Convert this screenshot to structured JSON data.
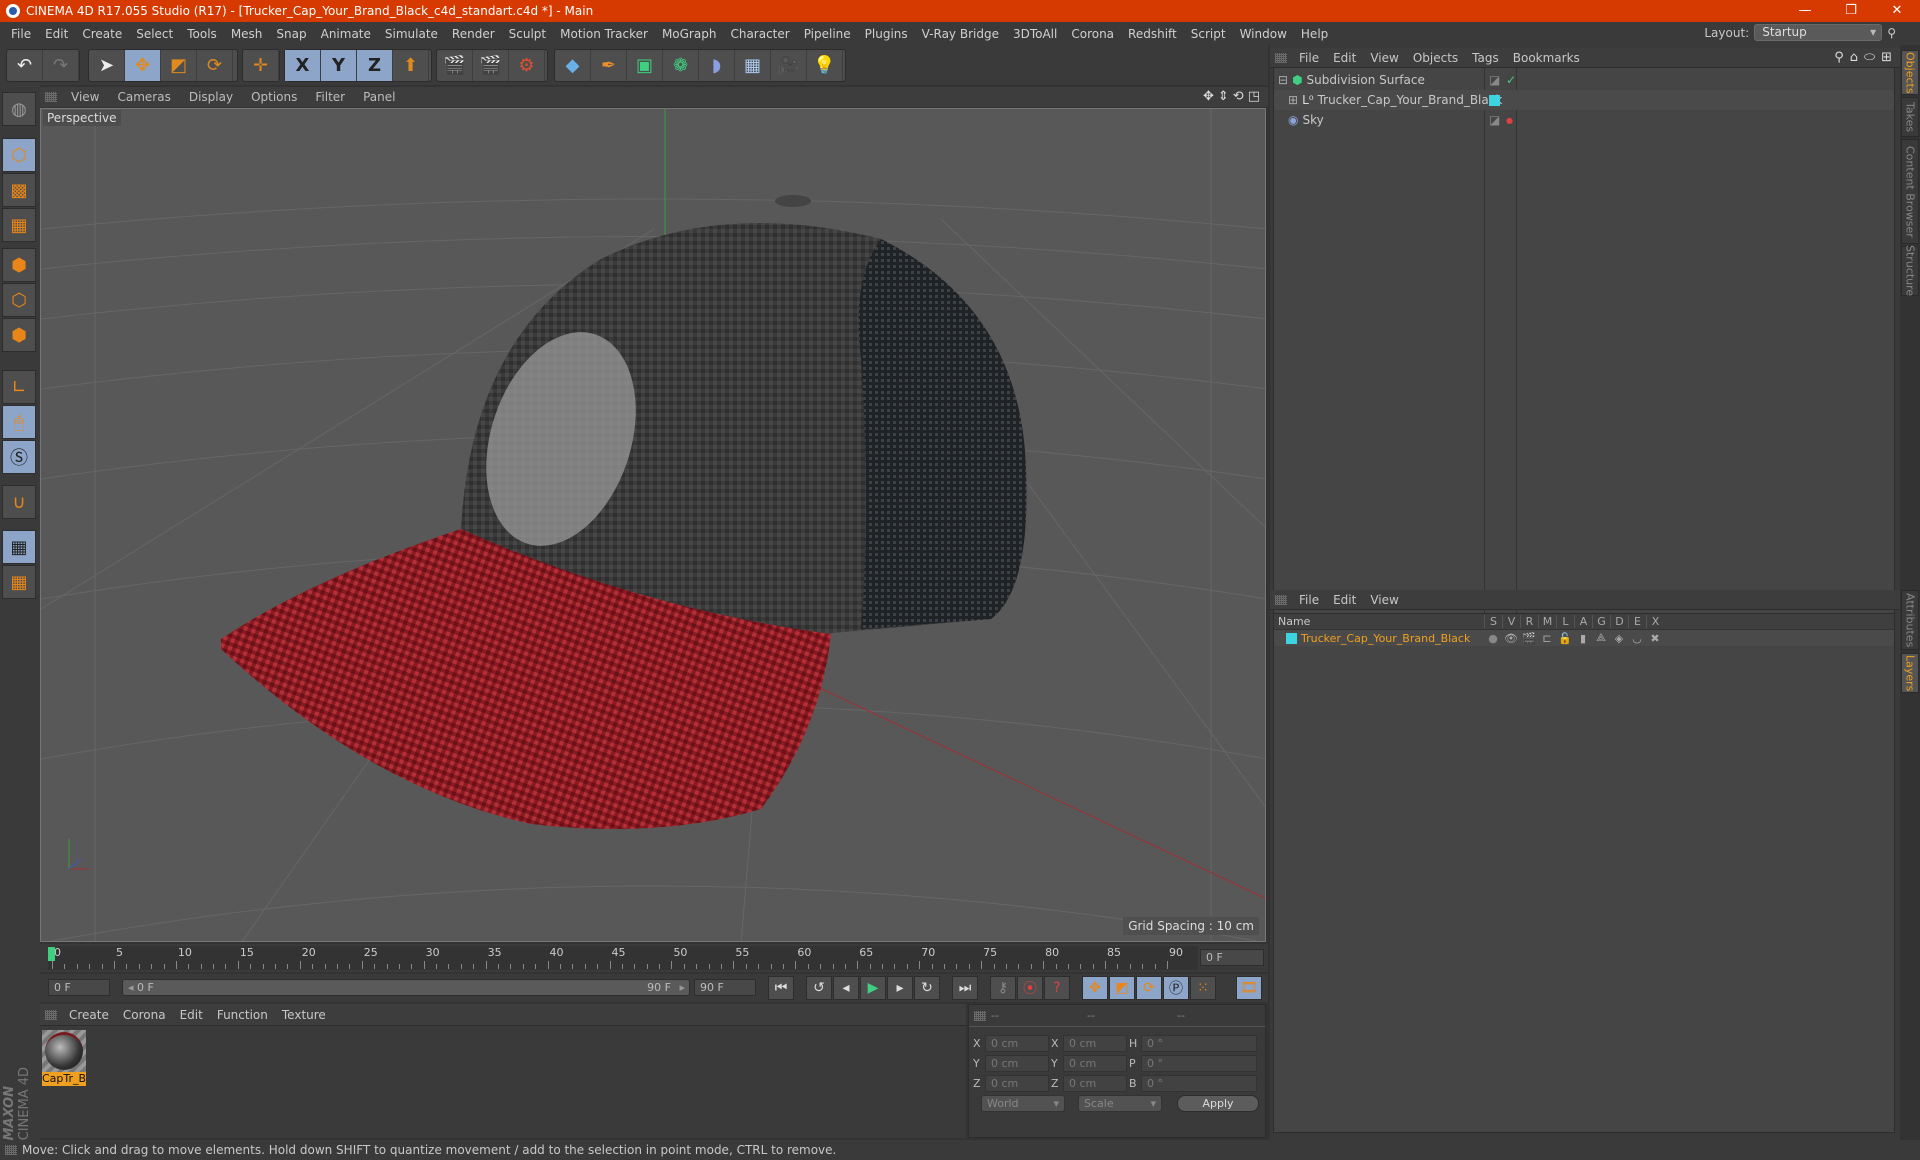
{
  "window": {
    "title": "CINEMA 4D R17.055 Studio (R17) - [Trucker_Cap_Your_Brand_Black_c4d_standart.c4d *] - Main",
    "controls": [
      "minimize",
      "restore",
      "close"
    ]
  },
  "menubar": {
    "items": [
      "File",
      "Edit",
      "Create",
      "Select",
      "Tools",
      "Mesh",
      "Snap",
      "Animate",
      "Simulate",
      "Render",
      "Sculpt",
      "Motion Tracker",
      "MoGraph",
      "Character",
      "Pipeline",
      "Plugins",
      "V-Ray Bridge",
      "3DToAll",
      "Corona",
      "Redshift",
      "Script",
      "Window",
      "Help"
    ],
    "layout_label": "Layout:",
    "layout_value": "Startup"
  },
  "toolbar": {
    "groups": [
      [
        "undo-icon",
        "redo-icon"
      ],
      [
        "select-icon",
        "move-icon",
        "scale-icon",
        "rotate-icon"
      ],
      [
        "live-move-icon"
      ],
      [
        "x-axis-icon",
        "y-axis-icon",
        "z-axis-icon",
        "coordinate-system-icon"
      ],
      [
        "render-view-icon",
        "render-picture-viewer-icon",
        "render-settings-icon"
      ],
      [
        "cube-icon",
        "pen-spline-icon",
        "subdivision-icon",
        "cloner-icon",
        "deformer-icon",
        "floor-icon",
        "camera-icon",
        "light-icon"
      ]
    ],
    "axis_labels": [
      "X",
      "Y",
      "Z"
    ]
  },
  "left_tools": [
    "model-mode-icon",
    "object-mode-icon",
    "texture-mode-icon",
    "workplane-mode-icon",
    "points-mode-icon",
    "edges-mode-icon",
    "polygons-mode-icon",
    "axis-mode-icon",
    "tweak-mode-icon",
    "snap-settings-icon",
    "magnet-icon",
    "workplane-lock-icon",
    "workplane-align-icon"
  ],
  "viewport": {
    "menu": [
      "View",
      "Cameras",
      "Display",
      "Options",
      "Filter",
      "Panel"
    ],
    "camera_label": "Perspective",
    "grid_spacing": "Grid Spacing : 10 cm",
    "nav_icons": [
      "pan-icon",
      "dolly-icon",
      "orbit-icon",
      "maximize-icon"
    ],
    "axis_gizmo": [
      "X",
      "Y",
      "Z"
    ]
  },
  "object_manager": {
    "menu": [
      "File",
      "Edit",
      "View",
      "Objects",
      "Tags",
      "Bookmarks"
    ],
    "objects": [
      {
        "name": "Subdivision Surface",
        "icon": "subdivision-icon",
        "tag": "checkmark"
      },
      {
        "name": "Trucker_Cap_Your_Brand_Black",
        "icon": "null-object-icon",
        "tag": "layer-color"
      },
      {
        "name": "Sky",
        "icon": "sky-icon",
        "tag": "none"
      }
    ]
  },
  "layer_manager": {
    "menu": [
      "File",
      "Edit",
      "View"
    ],
    "columns": [
      "Name",
      "S",
      "V",
      "R",
      "M",
      "L",
      "A",
      "G",
      "D",
      "E",
      "X"
    ],
    "layers": [
      {
        "name": "Trucker_Cap_Your_Brand_Black",
        "color": "#3ed3e0"
      }
    ]
  },
  "side_tabs_top": [
    {
      "label": "Objects",
      "active": true
    },
    {
      "label": "Takes",
      "active": false
    },
    {
      "label": "Content Browser",
      "active": false
    },
    {
      "label": "Structure",
      "active": false
    }
  ],
  "side_tabs_bottom": [
    {
      "label": "Attributes",
      "active": false
    },
    {
      "label": "Layers",
      "active": true
    }
  ],
  "timeline": {
    "ticks": [
      "0",
      "5",
      "10",
      "15",
      "20",
      "25",
      "30",
      "35",
      "40",
      "45",
      "50",
      "55",
      "60",
      "65",
      "70",
      "75",
      "80",
      "85",
      "90"
    ],
    "current_frame": "0 F",
    "start_frame": "0 F",
    "range_start": "0 F",
    "range_end": "90 F",
    "end_frame": "90 F"
  },
  "materials": {
    "menu": [
      "Create",
      "Corona",
      "Edit",
      "Function",
      "Texture"
    ],
    "items": [
      {
        "name": "CapTr_B",
        "selected": true
      }
    ]
  },
  "coordinates": {
    "headers": [
      "--",
      "--",
      "--"
    ],
    "rows": [
      {
        "l1": "X",
        "v1": "0 cm",
        "l2": "X",
        "v2": "0 cm",
        "l3": "H",
        "v3": "0 °"
      },
      {
        "l1": "Y",
        "v1": "0 cm",
        "l2": "Y",
        "v2": "0 cm",
        "l3": "P",
        "v3": "0 °"
      },
      {
        "l1": "Z",
        "v1": "0 cm",
        "l2": "Z",
        "v2": "0 cm",
        "l3": "B",
        "v3": "0 °"
      }
    ],
    "space": "World",
    "mode": "Scale",
    "apply_label": "Apply"
  },
  "brand": {
    "line1": "MAXON",
    "line2": "CINEMA 4D"
  },
  "status": "Move: Click and drag to move elements. Hold down SHIFT to quantize movement / add to the selection in point mode, CTRL to remove.",
  "colors": {
    "titlebar": "#d63a00",
    "accent_orange": "#f0a020",
    "active_button": "#8ca5c8",
    "cap_visor": "#a3222a",
    "cap_crown": "#3a3a3a"
  }
}
